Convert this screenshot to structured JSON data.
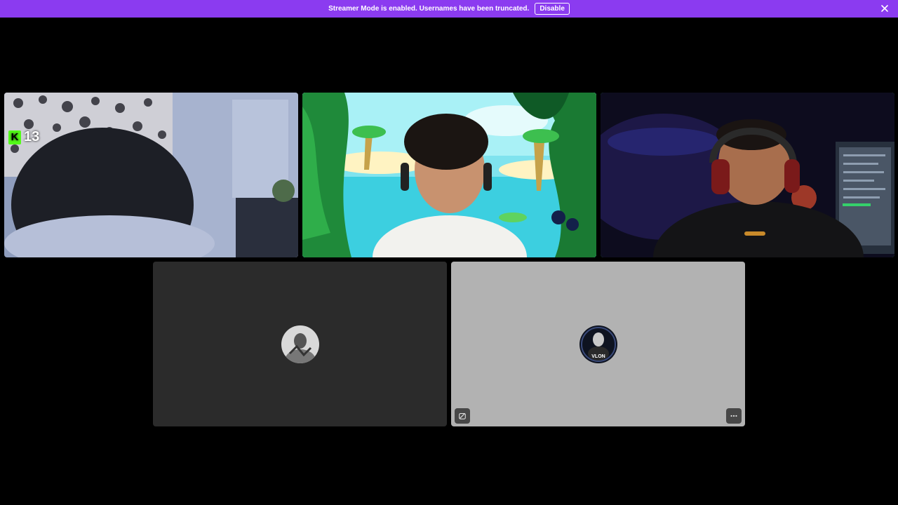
{
  "banner": {
    "message": "Streamer Mode is enabled. Usernames have been truncated.",
    "disable_label": "Disable",
    "background": "#8b3bf0"
  },
  "tiles": [
    {
      "name": "video-tile-1",
      "type": "camera",
      "overlay_badge": {
        "icon": "kick-logo-icon",
        "value": "13"
      }
    },
    {
      "name": "video-tile-2",
      "type": "camera",
      "speaking": true
    },
    {
      "name": "video-tile-3",
      "type": "camera",
      "speaking": true
    },
    {
      "name": "avatar-tile-1",
      "type": "avatar",
      "background": "#2b2b2b",
      "avatar_icon": "user-avatar-icon"
    },
    {
      "name": "avatar-tile-2",
      "type": "avatar",
      "background": "#b2b2b2",
      "avatar_icon": "user-avatar-icon",
      "avatar_text": "VLON",
      "controls": [
        "popout-icon",
        "more-options-icon"
      ]
    }
  ],
  "colors": {
    "speaking_outline": "#43b581",
    "kick_green": "#53fc18"
  }
}
